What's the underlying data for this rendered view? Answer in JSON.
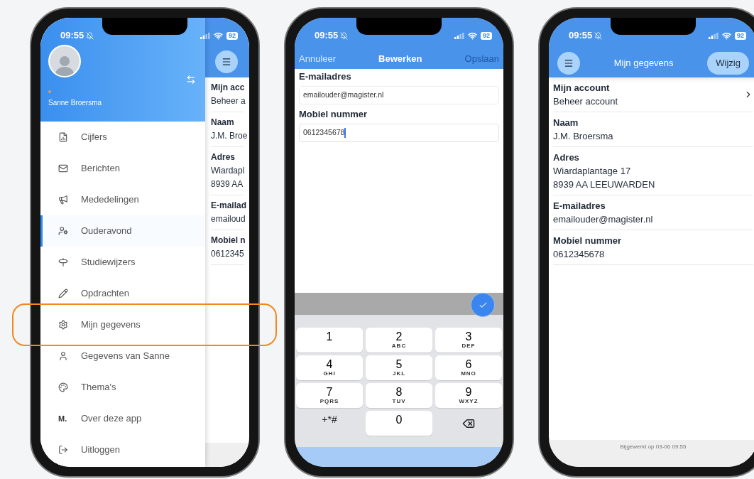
{
  "phones": [
    {
      "kind": "menu",
      "status_bar": {
        "time": "09:55",
        "battery": "92"
      },
      "drawer": {
        "user_name": "Sanne Broersma",
        "items": [
          {
            "kind": "grades",
            "label": "Cijfers",
            "selected": false,
            "highlighted": false
          },
          {
            "kind": "messages",
            "label": "Berichten",
            "selected": false,
            "highlighted": false
          },
          {
            "kind": "announcements",
            "label": "Mededelingen",
            "selected": false,
            "highlighted": false
          },
          {
            "kind": "meeting",
            "label": "Ouderavond",
            "selected": true,
            "highlighted": false
          },
          {
            "kind": "guides",
            "label": "Studiewijzers",
            "selected": false,
            "highlighted": false
          },
          {
            "kind": "assignments",
            "label": "Opdrachten",
            "selected": false,
            "highlighted": false
          },
          {
            "kind": "settings",
            "label": "Mijn gegevens",
            "selected": false,
            "highlighted": true
          },
          {
            "kind": "person",
            "label": "Gegevens van Sanne",
            "selected": false,
            "highlighted": false
          },
          {
            "kind": "themes",
            "label": "Thema's",
            "selected": false,
            "highlighted": false
          },
          {
            "kind": "logo",
            "logo_text": "M.",
            "label": "Over deze app",
            "selected": false,
            "highlighted": false
          },
          {
            "kind": "logout",
            "label": "Uitloggen",
            "selected": false,
            "highlighted": false
          }
        ]
      },
      "page": {
        "rows": [
          {
            "label": "Mijn acc",
            "lines": [
              "Beheer a"
            ]
          },
          {
            "label": "Naam",
            "lines": [
              "J.M. Broe"
            ]
          },
          {
            "label": "Adres",
            "lines": [
              "Wiardapl",
              "8939 AA"
            ]
          },
          {
            "label": "E-mailad",
            "lines": [
              "emailoud"
            ]
          },
          {
            "label": "Mobiel n",
            "lines": [
              "0612345"
            ]
          }
        ]
      }
    },
    {
      "kind": "edit",
      "status_bar": {
        "time": "09:55",
        "battery": "92"
      },
      "nav": {
        "cancel": "Annuleer",
        "title": "Bewerken",
        "save": {
          "label": "Opslaan",
          "disabled": true
        }
      },
      "fields": [
        {
          "label": "E-mailadres",
          "value": "emailouder@magister.nl",
          "focused": false
        },
        {
          "label": "Mobiel nummer",
          "value": "0612345678",
          "focused": true
        }
      ],
      "keypad": [
        {
          "kind": "digit",
          "digit": "1"
        },
        {
          "kind": "digit",
          "digit": "2",
          "letters": "ABC"
        },
        {
          "kind": "digit",
          "digit": "3",
          "letters": "DEF"
        },
        {
          "kind": "digit",
          "digit": "4",
          "letters": "GHI"
        },
        {
          "kind": "digit",
          "digit": "5",
          "letters": "JKL"
        },
        {
          "kind": "digit",
          "digit": "6",
          "letters": "MNO"
        },
        {
          "kind": "digit",
          "digit": "7",
          "letters": "PQRS"
        },
        {
          "kind": "digit",
          "digit": "8",
          "letters": "TUV"
        },
        {
          "kind": "digit",
          "digit": "9",
          "letters": "WXYZ"
        },
        {
          "kind": "symbols",
          "label": "+*#"
        },
        {
          "kind": "digit",
          "digit": "0"
        },
        {
          "kind": "delete"
        }
      ]
    },
    {
      "kind": "details",
      "status_bar": {
        "time": "09:55",
        "battery": "92"
      },
      "nav": {
        "title": "Mijn gegevens",
        "action": "Wijzig"
      },
      "rows": [
        {
          "label": "Mijn account",
          "lines": [
            "Beheer account"
          ],
          "link": true
        },
        {
          "label": "Naam",
          "lines": [
            "J.M. Broersma"
          ],
          "link": false
        },
        {
          "label": "Adres",
          "lines": [
            "Wiardaplantage 17",
            "8939 AA LEEUWARDEN"
          ],
          "link": false
        },
        {
          "label": "E-mailadres",
          "lines": [
            "emailouder@magister.nl"
          ],
          "link": false
        },
        {
          "label": "Mobiel nummer",
          "lines": [
            "0612345678"
          ],
          "link": false
        }
      ],
      "footer": "Bijgewerkt op 03-06 09:55"
    }
  ]
}
